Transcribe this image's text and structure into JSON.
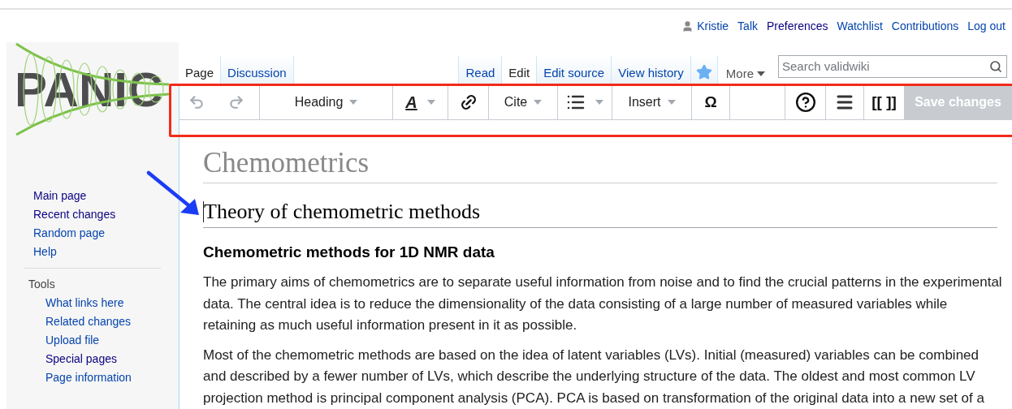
{
  "personal_tools": [
    {
      "kind": "user",
      "label": "Kristie",
      "visited": false
    },
    {
      "kind": "link",
      "label": "Talk",
      "visited": false
    },
    {
      "kind": "link",
      "label": "Preferences",
      "visited": true
    },
    {
      "kind": "link",
      "label": "Watchlist",
      "visited": false
    },
    {
      "kind": "link",
      "label": "Contributions",
      "visited": false
    },
    {
      "kind": "link",
      "label": "Log out",
      "visited": false
    }
  ],
  "logo": {
    "text": "PANIC"
  },
  "namespace_tabs": [
    {
      "label": "Page",
      "selected": true
    },
    {
      "label": "Discussion",
      "selected": false
    }
  ],
  "view_tabs": [
    {
      "kind": "tab",
      "label": "Read",
      "selected": false
    },
    {
      "kind": "tab",
      "label": "Edit",
      "selected": true
    },
    {
      "kind": "tab",
      "label": "Edit source",
      "selected": false
    },
    {
      "kind": "tab",
      "label": "View history",
      "selected": false
    },
    {
      "kind": "watch-star",
      "on": true
    },
    {
      "kind": "menu",
      "label": "More"
    }
  ],
  "search": {
    "placeholder": "Search validwiki"
  },
  "sidebar": {
    "navigation": [
      {
        "label": "Main page",
        "visited": true
      },
      {
        "label": "Recent changes",
        "visited": true
      },
      {
        "label": "Random page",
        "visited": false
      },
      {
        "label": "Help",
        "visited": false
      }
    ],
    "tools": {
      "heading": "Tools",
      "items": [
        {
          "label": "What links here",
          "visited": false
        },
        {
          "label": "Related changes",
          "visited": false
        },
        {
          "label": "Upload file",
          "visited": false
        },
        {
          "label": "Special pages",
          "visited": true
        },
        {
          "label": "Page information",
          "visited": false
        }
      ]
    }
  },
  "toolbar": [
    {
      "kind": "undo",
      "disabled": true
    },
    {
      "kind": "redo",
      "disabled": true
    },
    {
      "kind": "dropdown",
      "label": "Heading"
    },
    {
      "kind": "style-dropdown",
      "label": "A"
    },
    {
      "kind": "link"
    },
    {
      "kind": "dropdown",
      "label": "Cite"
    },
    {
      "kind": "list-dropdown"
    },
    {
      "kind": "dropdown",
      "label": "Insert"
    },
    {
      "kind": "char",
      "label": "Ω"
    },
    {
      "kind": "spacer"
    },
    {
      "kind": "help"
    },
    {
      "kind": "menu"
    },
    {
      "kind": "char",
      "label": "[[ ]]"
    },
    {
      "kind": "save",
      "label": "Save changes",
      "disabled": true
    }
  ],
  "content": {
    "title": "Chemometrics",
    "heading": "Theory of chemometric methods",
    "subheading": "Chemometric methods for 1D NMR data",
    "paragraphs": [
      "The primary aims of chemometrics are to separate useful information from noise and to find the crucial patterns in the experimental data. The central idea is to reduce the dimensionality of the data consisting of a large number of measured variables while retaining as much useful information present in it as possible.",
      "Most of the chemometric methods are based on the idea of latent variables (LVs). Initial (measured) variables can be combined and described by a fewer number of LVs, which describe the underlying structure of the data. The oldest and most common LV projection method is principal component analysis (PCA). PCA is based on transformation of the original data into a new set of a"
    ]
  }
}
